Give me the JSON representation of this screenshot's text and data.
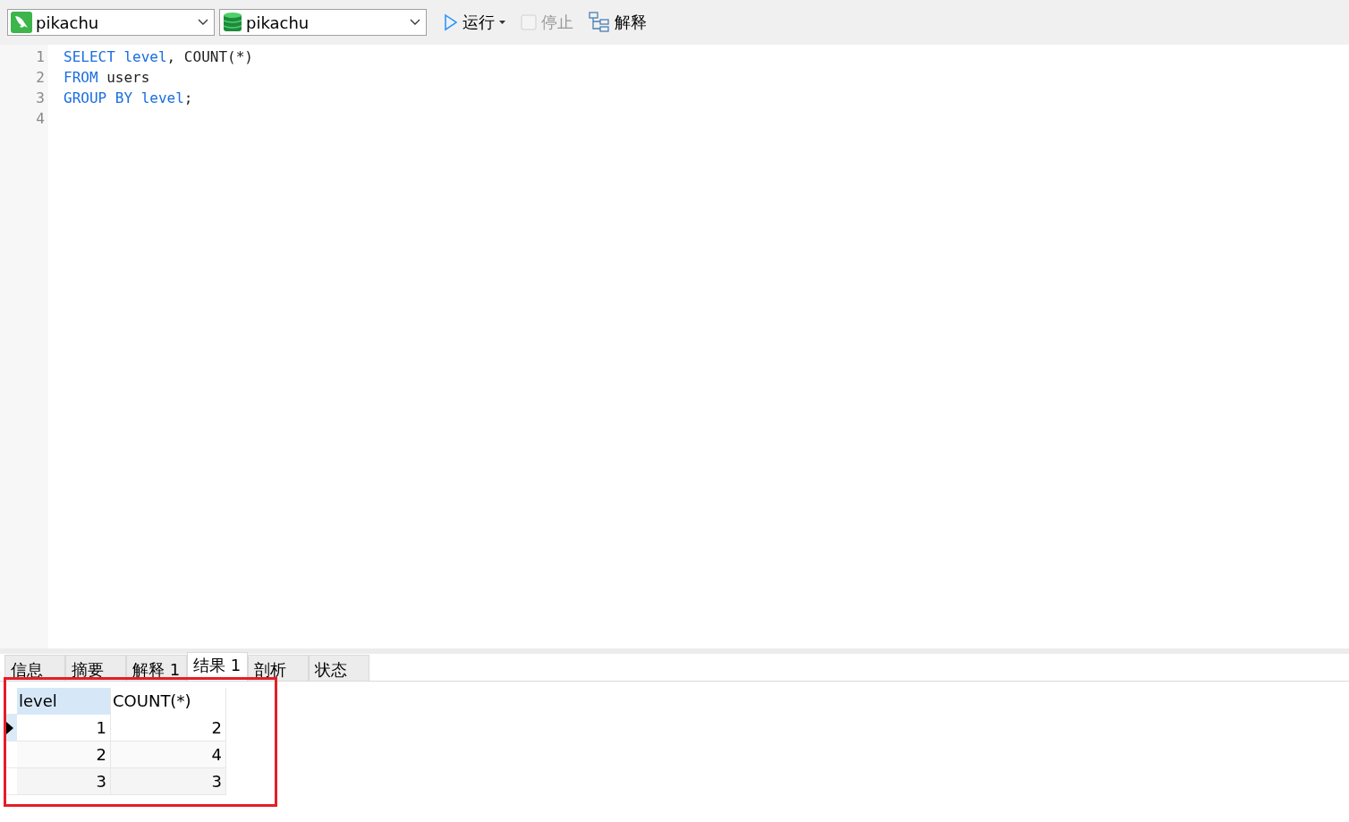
{
  "toolbar": {
    "connection": "pikachu",
    "database": "pikachu",
    "run": {
      "label": "运行",
      "disabled": false
    },
    "stop": {
      "label": "停止",
      "disabled": true
    },
    "explain": {
      "label": "解释",
      "disabled": false
    }
  },
  "editor": {
    "lines": [
      {
        "number": "1",
        "tokens": [
          {
            "text": "SELECT level",
            "kind": "keyword"
          },
          {
            "text": ", COUNT(*)",
            "kind": "plain"
          }
        ]
      },
      {
        "number": "2",
        "tokens": [
          {
            "text": "FROM",
            "kind": "keyword"
          },
          {
            "text": " users",
            "kind": "plain"
          }
        ]
      },
      {
        "number": "3",
        "tokens": [
          {
            "text": "GROUP BY level",
            "kind": "keyword"
          },
          {
            "text": ";",
            "kind": "plain"
          }
        ]
      },
      {
        "number": "4"
      }
    ]
  },
  "tabs": [
    {
      "label": "信息",
      "selected": false
    },
    {
      "label": "摘要",
      "selected": false
    },
    {
      "label": "解释 1",
      "selected": false
    },
    {
      "label": "结果 1",
      "selected": true
    },
    {
      "label": "剖析",
      "selected": false
    },
    {
      "label": "状态",
      "selected": false
    }
  ],
  "table": {
    "columns": [
      {
        "label": "level",
        "selected": true
      },
      {
        "label": "COUNT(*)",
        "selected": false
      }
    ],
    "rows": [
      {
        "cells": [
          "1",
          "2"
        ],
        "selected": true
      },
      {
        "cells": [
          "2",
          "4"
        ],
        "selected": false
      },
      {
        "cells": [
          "3",
          "3"
        ],
        "selected": false
      }
    ],
    "highlighted": true
  }
}
